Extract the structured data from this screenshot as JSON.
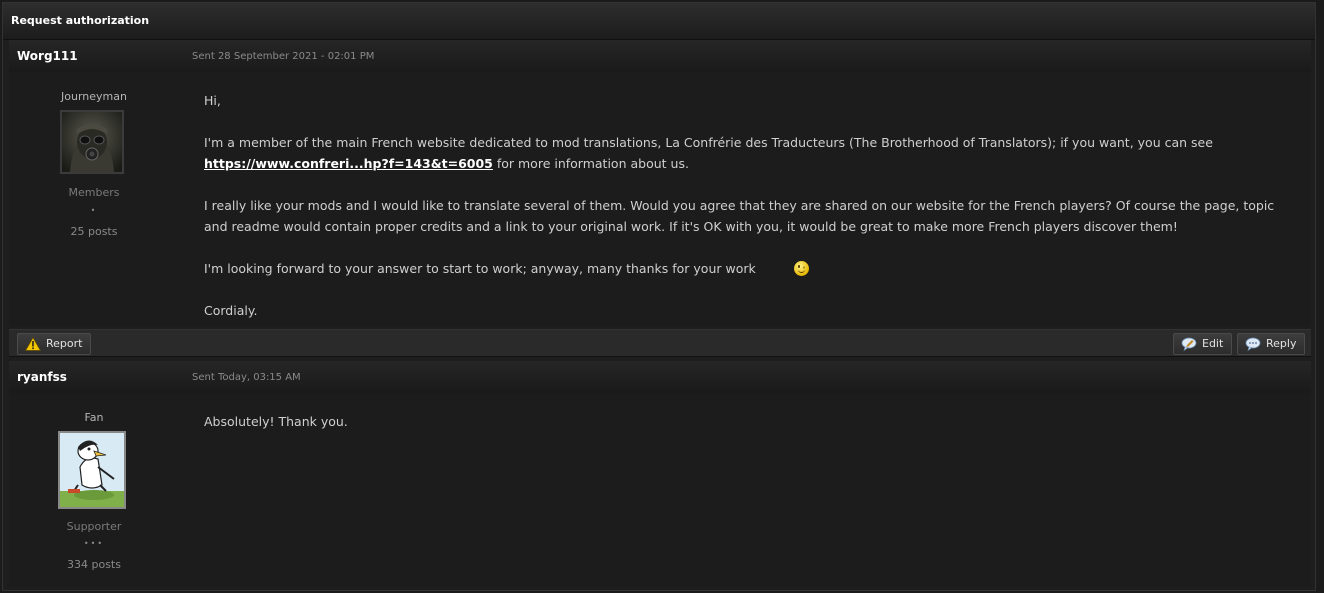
{
  "window": {
    "title": "Request authorization"
  },
  "posts": [
    {
      "author": "Worg111",
      "sent": "Sent 28 September 2021 - 02:01 PM",
      "rank": "Journeyman",
      "group": "Members",
      "pips": "•",
      "post_count": "25 posts",
      "p1": "Hi,",
      "p2_before": "I'm a member of the main French website dedicated to mod translations, La Confrérie des Traducteurs (The Brotherhood of Translators); if you want, you can see ",
      "p2_link": "https://www.confreri...hp?f=143&t=6005",
      "p2_after": " for more information about us.",
      "p3": "I really like your mods and I would like to translate several of them. Would you agree that they are shared on our website for the French players? Of course the page, topic and readme would contain proper credits and a link to your original work. If it's OK with you, it would be great to make more French players discover them!",
      "p4": "I'm looking forward to your answer to start to work; anyway, many thanks for your work",
      "p5": "Cordialy."
    },
    {
      "author": "ryanfss",
      "sent": "Sent Today, 03:15 AM",
      "rank": "Fan",
      "group": "Supporter",
      "pips": "•••",
      "post_count": "334 posts",
      "p1": "Absolutely! Thank you."
    }
  ],
  "actions": {
    "report_label": "Report",
    "edit_label": "Edit",
    "reply_label": "Reply"
  },
  "icons": {
    "report": "warning-icon",
    "edit": "edit-bubble-icon",
    "reply": "reply-bubble-icon"
  }
}
